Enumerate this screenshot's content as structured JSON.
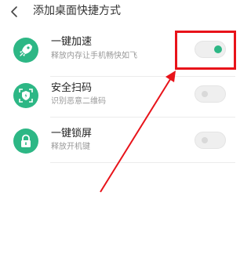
{
  "header": {
    "title": "添加桌面快捷方式",
    "back_icon": "chevron-left-icon"
  },
  "items": [
    {
      "title": "一键加速",
      "subtitle": "释放内存让手机畅快如飞",
      "icon": "rocket-icon",
      "enabled": true
    },
    {
      "title": "安全扫码",
      "subtitle": "识别恶意二维码",
      "icon": "shield-scan-icon",
      "enabled": false
    },
    {
      "title": "一键锁屏",
      "subtitle": "释放开机键",
      "icon": "lock-icon",
      "enabled": false
    }
  ],
  "colors": {
    "accent": "#2db785",
    "annotation": "#e8131a"
  }
}
